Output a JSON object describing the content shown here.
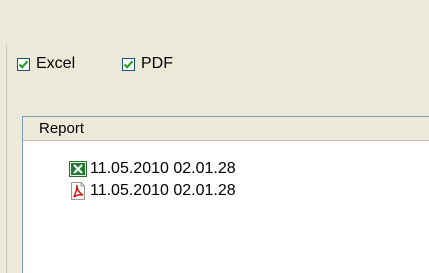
{
  "options": {
    "excel_label": "Excel",
    "excel_checked": true,
    "pdf_label": "PDF",
    "pdf_checked": true
  },
  "report_list": {
    "column_header": "Report",
    "rows": [
      {
        "icon": "excel-file-icon",
        "text": "11.05.2010 02.01.28"
      },
      {
        "icon": "pdf-file-icon",
        "text": "11.05.2010 02.01.28"
      }
    ]
  },
  "colors": {
    "window_background": "#ece9d8",
    "checkbox_border": "#1c5180",
    "checkmark": "#21a121",
    "excel_icon": "#1f7a32",
    "pdf_icon": "#d4201c"
  }
}
